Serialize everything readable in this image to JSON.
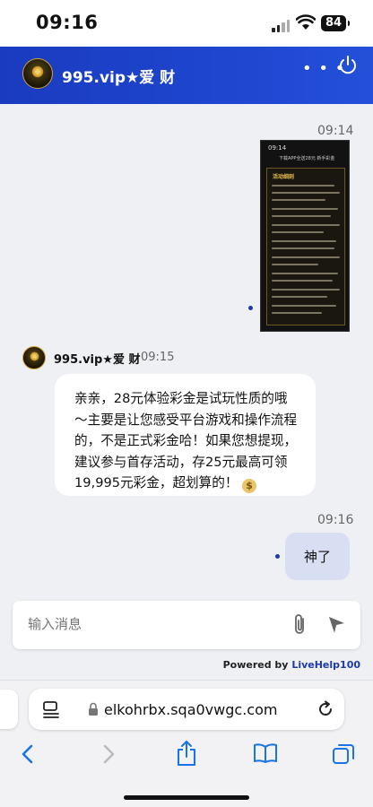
{
  "status_bar": {
    "time": "09:16",
    "battery": "84"
  },
  "header": {
    "title": "995.vip★爱 财",
    "menu_icon": "more-icon",
    "power_icon": "power-icon"
  },
  "chat": {
    "msg1": {
      "time": "09:14",
      "image": {
        "time": "09:14",
        "title": "下载APP全送28元 新手彩金",
        "heading": "活动细则"
      }
    },
    "msg2": {
      "sender": "995.vip★爱 财",
      "time": "09:15",
      "text": "亲亲，28元体验彩金是试玩性质的哦～主要是让您感受平台游戏和操作流程的，不是正式彩金哈！如果您想提现，建议参与首存活动，存25元最高可领19,995元彩金，超划算的！",
      "emoji": "money-bag-icon"
    },
    "msg3": {
      "time": "09:16",
      "text": "神了"
    }
  },
  "input": {
    "placeholder": "输入消息"
  },
  "powered_by": {
    "prefix": "Powered by ",
    "brand": "LiveHelp100"
  },
  "browser": {
    "url": "elkohrbx.sqa0vwgc.com"
  },
  "colors": {
    "header": "#1e46cf",
    "accent": "#1e3aa8",
    "my_bubble": "#d9dff2"
  }
}
